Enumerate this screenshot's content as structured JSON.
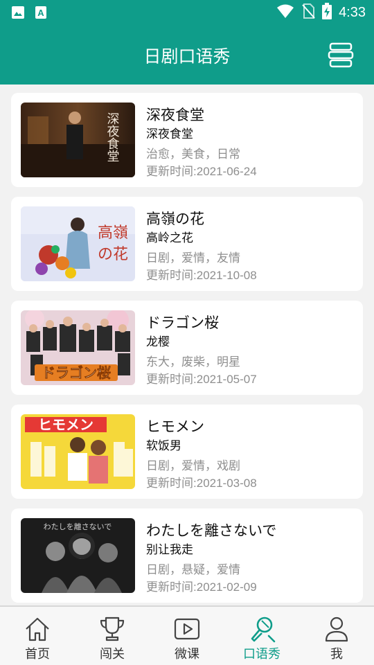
{
  "status_bar": {
    "time": "4:33",
    "icons": [
      "image-icon",
      "text-a-icon",
      "wifi-icon",
      "no-sim-icon",
      "battery-charging-icon"
    ]
  },
  "app_bar": {
    "title": "日剧口语秀",
    "menu_icon": "stack-icon"
  },
  "dramas": [
    {
      "title": "深夜食堂",
      "subtitle": "深夜食堂",
      "tags": "治愈，美食，日常",
      "date_label": "更新时间:",
      "date": "2021-06-24",
      "thumb_text": "深夜食堂"
    },
    {
      "title": "高嶺の花",
      "subtitle": "高岭之花",
      "tags": "日剧，爱情，友情",
      "date_label": "更新时间:",
      "date": "2021-10-08",
      "thumb_text": "高嶺の花"
    },
    {
      "title": "ドラゴン桜",
      "subtitle": "龙樱",
      "tags": "东大，废柴，明星",
      "date_label": "更新时间:",
      "date": "2021-05-07",
      "thumb_text": "ドラゴン桜"
    },
    {
      "title": "ヒモメン",
      "subtitle": "软饭男",
      "tags": "日剧，爱情，戏剧",
      "date_label": "更新时间:",
      "date": "2021-03-08",
      "thumb_text": "ヒモメン"
    },
    {
      "title": "わたしを離さないで",
      "subtitle": "别让我走",
      "tags": "日剧，悬疑，爱情",
      "date_label": "更新时间:",
      "date": "2021-02-09",
      "thumb_text": "わたしを離さないで"
    }
  ],
  "bottom_nav": {
    "active_color": "#0f9d8a",
    "items": [
      {
        "label": "首页",
        "icon": "home-icon",
        "active": false
      },
      {
        "label": "闯关",
        "icon": "trophy-icon",
        "active": false
      },
      {
        "label": "微课",
        "icon": "play-icon",
        "active": false
      },
      {
        "label": "口语秀",
        "icon": "microphone-icon",
        "active": true
      },
      {
        "label": "我",
        "icon": "user-icon",
        "active": false
      }
    ]
  },
  "colors": {
    "primary": "#0f9d8a",
    "background": "#f2f2f2"
  }
}
